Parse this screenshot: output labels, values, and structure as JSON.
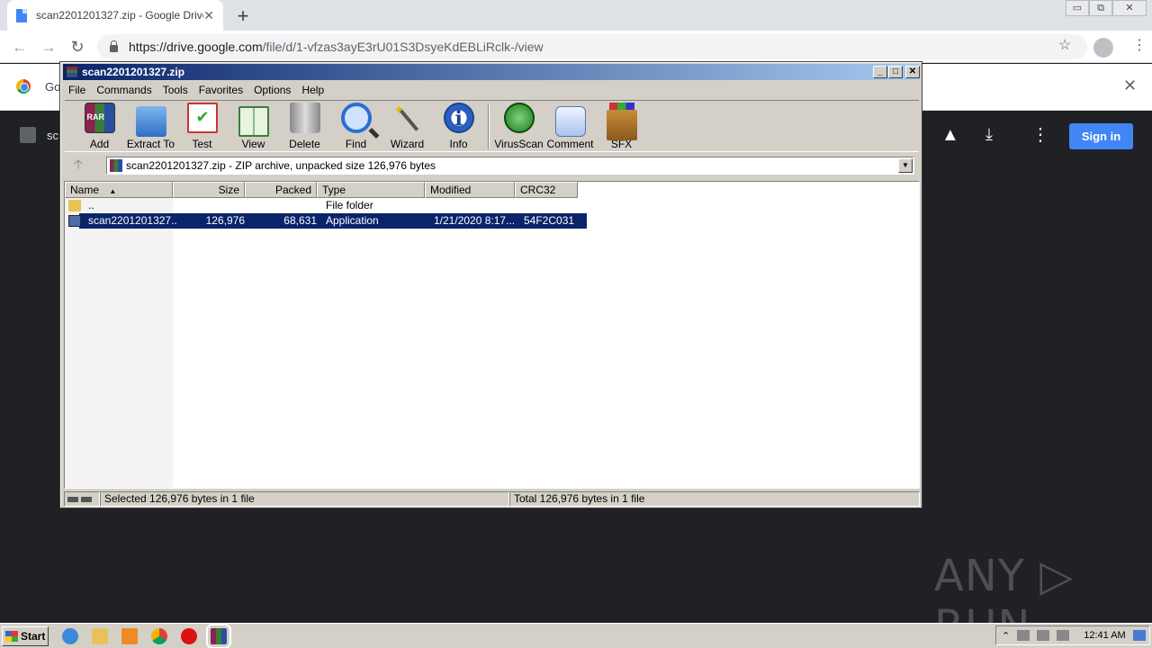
{
  "browser": {
    "tab_title": "scan2201201327.zip - Google Drive",
    "tab_close": "✕",
    "new_tab": "+",
    "url_host": "https://drive.google.com",
    "url_path": "/file/d/1-vfzas3ayE3rU01S3DsyeKdEBLiRclk-/view",
    "window_controls": [
      "▭",
      "⧉",
      "✕"
    ]
  },
  "infobar": {
    "text": "Go",
    "close": "✕"
  },
  "drive": {
    "file_name": "sc",
    "sign_in": "Sign in"
  },
  "winrar": {
    "title": "scan2201201327.zip",
    "title_buttons": [
      "_",
      "□",
      "✕"
    ],
    "menu": [
      "File",
      "Commands",
      "Tools",
      "Favorites",
      "Options",
      "Help"
    ],
    "toolbar": [
      {
        "label": "Add",
        "icon": "add-icon"
      },
      {
        "label": "Extract To",
        "icon": "extract-icon"
      },
      {
        "label": "Test",
        "icon": "test-icon"
      },
      {
        "label": "View",
        "icon": "view-icon"
      },
      {
        "label": "Delete",
        "icon": "delete-icon"
      },
      {
        "label": "Find",
        "icon": "find-icon"
      },
      {
        "label": "Wizard",
        "icon": "wizard-icon"
      },
      {
        "label": "Info",
        "icon": "info-icon"
      },
      {
        "label": "VirusScan",
        "icon": "virusscan-icon"
      },
      {
        "label": "Comment",
        "icon": "comment-icon"
      },
      {
        "label": "SFX",
        "icon": "sfx-icon"
      }
    ],
    "path_text": "scan2201201327.zip - ZIP archive, unpacked size 126,976 bytes",
    "columns": [
      "Name",
      "Size",
      "Packed",
      "Type",
      "Modified",
      "CRC32"
    ],
    "rows": [
      {
        "name": "..",
        "size": "",
        "packed": "",
        "type": "File folder",
        "modified": "",
        "crc": ""
      },
      {
        "name": "scan2201201327...",
        "size": "126,976",
        "packed": "68,631",
        "type": "Application",
        "modified": "1/21/2020 8:17...",
        "crc": "54F2C031"
      }
    ],
    "status_left": "Selected 126,976 bytes in 1 file",
    "status_right": "Total 126,976 bytes in 1 file"
  },
  "taskbar": {
    "start": "Start",
    "clock": "12:41 AM"
  },
  "watermark": "ANY ▷ RUN"
}
